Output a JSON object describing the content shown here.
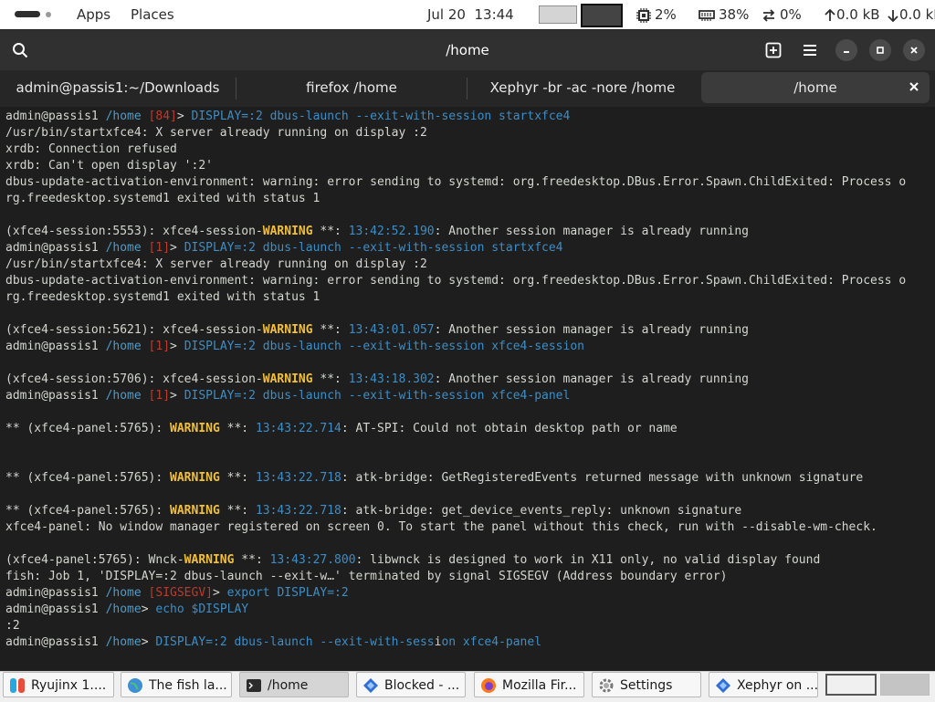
{
  "topbar": {
    "apps": "Apps",
    "places": "Places",
    "clock": "Jul 20  13:44",
    "cpu": "2%",
    "memory": "38%",
    "swap": "0%",
    "upload": "0.0 kB",
    "download": "0.0 kB"
  },
  "window": {
    "title": "/home"
  },
  "tabs": [
    {
      "label": "admin@passis1:~/Downloads"
    },
    {
      "label": "firefox /home"
    },
    {
      "label": "Xephyr -br -ac -nore /home"
    },
    {
      "label": "/home"
    }
  ],
  "terminal": {
    "lines": [
      [
        {
          "t": "admin@passis1 "
        },
        {
          "t": "/home ",
          "c": "path"
        },
        {
          "t": "[84]",
          "c": "code"
        },
        {
          "t": "> "
        },
        {
          "t": "DISPLAY=:2 dbus-launch --exit-with-session startxfce4",
          "c": "cmd"
        }
      ],
      [
        {
          "t": "/usr/bin/startxfce4: X server already running on display :2"
        }
      ],
      [
        {
          "t": "xrdb: Connection refused"
        }
      ],
      [
        {
          "t": "xrdb: Can't open display ':2'"
        }
      ],
      [
        {
          "t": "dbus-update-activation-environment: warning: error sending to systemd: org.freedesktop.DBus.Error.Spawn.ChildExited: Process o"
        }
      ],
      [
        {
          "t": "rg.freedesktop.systemd1 exited with status 1"
        }
      ],
      [
        {
          "t": ""
        }
      ],
      [
        {
          "t": "(xfce4-session:5553): xfce4-session-"
        },
        {
          "t": "WARNING",
          "c": "warn"
        },
        {
          "t": " **: "
        },
        {
          "t": "13:42:52.190",
          "c": "time"
        },
        {
          "t": ": Another session manager is already running"
        }
      ],
      [
        {
          "t": "admin@passis1 "
        },
        {
          "t": "/home ",
          "c": "path"
        },
        {
          "t": "[1]",
          "c": "code"
        },
        {
          "t": "> "
        },
        {
          "t": "DISPLAY=:2 dbus-launch --exit-with-session startxfce4",
          "c": "cmd"
        }
      ],
      [
        {
          "t": "/usr/bin/startxfce4: X server already running on display :2"
        }
      ],
      [
        {
          "t": "dbus-update-activation-environment: warning: error sending to systemd: org.freedesktop.DBus.Error.Spawn.ChildExited: Process o"
        }
      ],
      [
        {
          "t": "rg.freedesktop.systemd1 exited with status 1"
        }
      ],
      [
        {
          "t": ""
        }
      ],
      [
        {
          "t": "(xfce4-session:5621): xfce4-session-"
        },
        {
          "t": "WARNING",
          "c": "warn"
        },
        {
          "t": " **: "
        },
        {
          "t": "13:43:01.057",
          "c": "time"
        },
        {
          "t": ": Another session manager is already running"
        }
      ],
      [
        {
          "t": "admin@passis1 "
        },
        {
          "t": "/home ",
          "c": "path"
        },
        {
          "t": "[1]",
          "c": "code"
        },
        {
          "t": "> "
        },
        {
          "t": "DISPLAY=:2 dbus-launch --exit-with-session xfce4-session",
          "c": "cmd"
        }
      ],
      [
        {
          "t": ""
        }
      ],
      [
        {
          "t": "(xfce4-session:5706): xfce4-session-"
        },
        {
          "t": "WARNING",
          "c": "warn"
        },
        {
          "t": " **: "
        },
        {
          "t": "13:43:18.302",
          "c": "time"
        },
        {
          "t": ": Another session manager is already running"
        }
      ],
      [
        {
          "t": "admin@passis1 "
        },
        {
          "t": "/home ",
          "c": "path"
        },
        {
          "t": "[1]",
          "c": "code"
        },
        {
          "t": "> "
        },
        {
          "t": "DISPLAY=:2 dbus-launch --exit-with-session xfce4-panel",
          "c": "cmd"
        }
      ],
      [
        {
          "t": ""
        }
      ],
      [
        {
          "t": "** (xfce4-panel:5765): "
        },
        {
          "t": "WARNING",
          "c": "warn"
        },
        {
          "t": " **: "
        },
        {
          "t": "13:43:22.714",
          "c": "time"
        },
        {
          "t": ": AT-SPI: Could not obtain desktop path or name"
        }
      ],
      [
        {
          "t": ""
        }
      ],
      [
        {
          "t": ""
        }
      ],
      [
        {
          "t": "** (xfce4-panel:5765): "
        },
        {
          "t": "WARNING",
          "c": "warn"
        },
        {
          "t": " **: "
        },
        {
          "t": "13:43:22.718",
          "c": "time"
        },
        {
          "t": ": atk-bridge: GetRegisteredEvents returned message with unknown signature"
        }
      ],
      [
        {
          "t": ""
        }
      ],
      [
        {
          "t": "** (xfce4-panel:5765): "
        },
        {
          "t": "WARNING",
          "c": "warn"
        },
        {
          "t": " **: "
        },
        {
          "t": "13:43:22.718",
          "c": "time"
        },
        {
          "t": ": atk-bridge: get_device_events_reply: unknown signature"
        }
      ],
      [
        {
          "t": "xfce4-panel: No window manager registered on screen 0. To start the panel without this check, run with --disable-wm-check."
        }
      ],
      [
        {
          "t": ""
        }
      ],
      [
        {
          "t": "(xfce4-panel:5765): Wnck-"
        },
        {
          "t": "WARNING",
          "c": "warn"
        },
        {
          "t": " **: "
        },
        {
          "t": "13:43:27.800",
          "c": "time"
        },
        {
          "t": ": libwnck is designed to work in X11 only, no valid display found"
        }
      ],
      [
        {
          "t": "fish: Job 1, 'DISPLAY=:2 dbus-launch --exit-w…' terminated by signal SIGSEGV (Address boundary error)"
        }
      ],
      [
        {
          "t": "admin@passis1 "
        },
        {
          "t": "/home ",
          "c": "path"
        },
        {
          "t": "[SIGSEGV]",
          "c": "code"
        },
        {
          "t": "> "
        },
        {
          "t": "export DISPLAY=:2",
          "c": "cmd"
        }
      ],
      [
        {
          "t": "admin@passis1 "
        },
        {
          "t": "/home",
          "c": "path"
        },
        {
          "t": "> "
        },
        {
          "t": "echo $DISPLAY",
          "c": "cmd"
        }
      ],
      [
        {
          "t": ":2"
        }
      ],
      [
        {
          "t": "admin@passis1 "
        },
        {
          "t": "/home",
          "c": "path"
        },
        {
          "t": "> "
        },
        {
          "t": "DISPLAY=:2 dbus-launch --exit-with-sess",
          "c": "cmd"
        },
        {
          "t": "i",
          "c": "cursor"
        },
        {
          "t": "on xfce4-panel",
          "c": "cmd"
        }
      ]
    ]
  },
  "taskbar": [
    {
      "label": "Ryujinx 1....",
      "icon": "ryujinx-icon"
    },
    {
      "label": "The fish la...",
      "icon": "globe-icon"
    },
    {
      "label": "/home",
      "icon": "terminal-icon"
    },
    {
      "label": "Blocked - ...",
      "icon": "xephyr-icon"
    },
    {
      "label": "Mozilla Fir...",
      "icon": "firefox-icon"
    },
    {
      "label": "Settings",
      "icon": "settings-icon"
    },
    {
      "label": "Xephyr on ...",
      "icon": "xephyr-icon"
    }
  ],
  "colors": {
    "prompt_path": "#4e9bc8",
    "prompt_code": "#c0392b",
    "command": "#3b8ec7",
    "warning": "#f2c037"
  }
}
